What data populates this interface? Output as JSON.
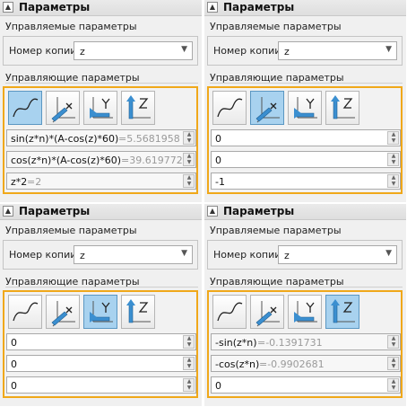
{
  "panels": [
    {
      "title": "Параметры",
      "managed_label": "Управляемые параметры",
      "copy_label": "Номер копии:",
      "copy_value": "z",
      "control_label": "Управляющие параметры",
      "selected_mode": 0,
      "fields": [
        {
          "expr": "sin(z*n)*(A-cos(z)*60)",
          "result": "=5.5681958"
        },
        {
          "expr": "cos(z*n)*(A-cos(z)*60)",
          "result": "=39.6197721"
        },
        {
          "expr": "z*2",
          "result": "=2"
        }
      ]
    },
    {
      "title": "Параметры",
      "managed_label": "Управляемые параметры",
      "copy_label": "Номер копии:",
      "copy_value": "z",
      "control_label": "Управляющие параметры",
      "selected_mode": 1,
      "fields": [
        {
          "expr": "0",
          "result": ""
        },
        {
          "expr": "0",
          "result": ""
        },
        {
          "expr": "-1",
          "result": ""
        }
      ]
    },
    {
      "title": "Параметры",
      "managed_label": "Управляемые параметры",
      "copy_label": "Номер копии:",
      "copy_value": "z",
      "control_label": "Управляющие параметры",
      "selected_mode": 2,
      "fields": [
        {
          "expr": "0",
          "result": ""
        },
        {
          "expr": "0",
          "result": ""
        },
        {
          "expr": "0",
          "result": ""
        }
      ]
    },
    {
      "title": "Параметры",
      "managed_label": "Управляемые параметры",
      "copy_label": "Номер копии:",
      "copy_value": "z",
      "control_label": "Управляющие параметры",
      "selected_mode": 3,
      "fields": [
        {
          "expr": "-sin(z*n)",
          "result": "=-0.1391731"
        },
        {
          "expr": "-cos(z*n)",
          "result": "=-0.9902681"
        },
        {
          "expr": "0",
          "result": ""
        }
      ]
    }
  ],
  "mode_icons": [
    "curve-path-icon",
    "axis-x-orient-icon",
    "axis-y-orient-icon",
    "axis-z-orient-icon"
  ],
  "colors": {
    "highlight_border": "#f0a81a",
    "selected_button": "#a8d2ef",
    "result_text": "#9a9a9a"
  }
}
